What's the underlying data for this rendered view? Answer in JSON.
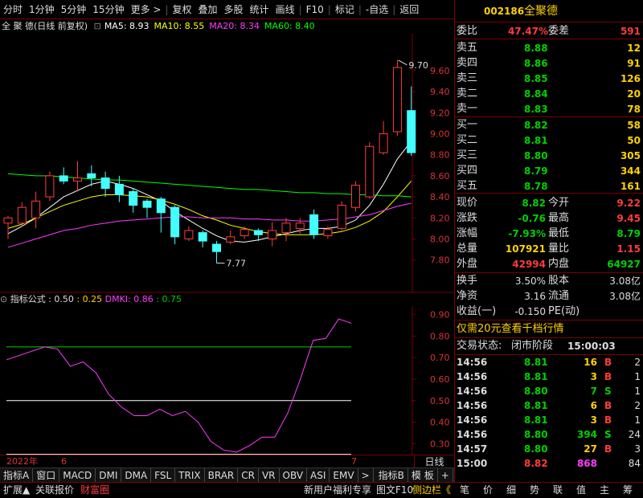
{
  "toolbar": {
    "items": [
      "分时",
      "1分钟",
      "5分钟",
      "15分钟",
      "更多 >",
      "复权",
      "叠加",
      "多股",
      "统计",
      "画线",
      "F10",
      "标记",
      "-自选",
      "返回"
    ]
  },
  "chart_header": {
    "name": "全 聚 德",
    "mode": "(日线 前复权)",
    "ma": [
      {
        "label": "MA5: 8.93",
        "color": "#ffffff"
      },
      {
        "label": "MA10: 8.55",
        "color": "#ffff00"
      },
      {
        "label": "MA20: 8.34",
        "color": "#ff3cff"
      },
      {
        "label": "MA60: 8.40",
        "color": "#00ff00"
      }
    ]
  },
  "chart_data": [
    {
      "type": "candlestick",
      "y_ticks": [
        7.8,
        8.0,
        8.2,
        8.4,
        8.6,
        8.8,
        9.0,
        9.2,
        9.4,
        9.6
      ],
      "ylim": [
        7.66,
        9.92
      ],
      "annotations": [
        {
          "label": "9.70",
          "value": 9.7
        },
        {
          "label": "7.77",
          "value": 7.77
        }
      ],
      "candles": [
        [
          8.15,
          8.2,
          8.22,
          8.0
        ],
        [
          8.15,
          8.3,
          8.35,
          8.12
        ],
        [
          8.2,
          8.36,
          8.45,
          8.1
        ],
        [
          8.4,
          8.6,
          8.64,
          8.36
        ],
        [
          8.6,
          8.55,
          8.68,
          8.52
        ],
        [
          8.55,
          8.58,
          8.74,
          8.45
        ],
        [
          8.62,
          8.58,
          8.7,
          8.5
        ],
        [
          8.58,
          8.48,
          8.64,
          8.4
        ],
        [
          8.52,
          8.42,
          8.6,
          8.35
        ],
        [
          8.45,
          8.32,
          8.48,
          8.25
        ],
        [
          8.36,
          8.3,
          8.38,
          8.2
        ],
        [
          8.38,
          8.25,
          8.4,
          8.06
        ],
        [
          8.3,
          8.02,
          8.32,
          7.95
        ],
        [
          8.0,
          8.08,
          8.12,
          7.98
        ],
        [
          8.06,
          7.98,
          8.08,
          7.92
        ],
        [
          7.95,
          7.88,
          7.98,
          7.77
        ],
        [
          7.97,
          8.02,
          8.08,
          7.95
        ],
        [
          8.03,
          8.09,
          8.12,
          8.0
        ],
        [
          8.08,
          8.04,
          8.1,
          7.98
        ],
        [
          8.0,
          8.08,
          8.16,
          7.93
        ],
        [
          8.06,
          8.15,
          8.2,
          7.98
        ],
        [
          8.1,
          8.15,
          8.2,
          8.05
        ],
        [
          8.23,
          8.04,
          8.28,
          8.0
        ],
        [
          8.03,
          8.09,
          8.12,
          8.0
        ],
        [
          8.1,
          8.32,
          8.36,
          8.08
        ],
        [
          8.3,
          8.51,
          8.55,
          8.26
        ],
        [
          8.4,
          8.88,
          8.92,
          8.38
        ],
        [
          8.82,
          9.0,
          9.12,
          8.8
        ],
        [
          9.02,
          9.63,
          9.7,
          8.98
        ],
        [
          9.22,
          8.82,
          9.45,
          8.79
        ]
      ],
      "ma_series": [
        {
          "name": "MA5",
          "color": "#ffffff",
          "values": [
            8.05,
            8.12,
            8.2,
            8.3,
            8.4,
            8.46,
            8.52,
            8.55,
            8.52,
            8.48,
            8.42,
            8.36,
            8.26,
            8.18,
            8.1,
            8.03,
            7.98,
            7.97,
            7.99,
            8.02,
            8.05,
            8.08,
            8.1,
            8.1,
            8.12,
            8.18,
            8.32,
            8.52,
            8.76,
            8.93
          ]
        },
        {
          "name": "MA10",
          "color": "#ffff00",
          "values": [
            8.1,
            8.14,
            8.2,
            8.26,
            8.32,
            8.36,
            8.4,
            8.42,
            8.42,
            8.41,
            8.4,
            8.37,
            8.33,
            8.28,
            8.22,
            8.18,
            8.13,
            8.1,
            8.07,
            8.05,
            8.04,
            8.04,
            8.04,
            8.05,
            8.07,
            8.11,
            8.17,
            8.26,
            8.4,
            8.55
          ]
        },
        {
          "name": "MA20",
          "color": "#ff3cff",
          "values": [
            7.92,
            7.96,
            8.0,
            8.04,
            8.08,
            8.1,
            8.13,
            8.15,
            8.17,
            8.18,
            8.19,
            8.2,
            8.21,
            8.21,
            8.2,
            8.2,
            8.2,
            8.19,
            8.19,
            8.18,
            8.18,
            8.17,
            8.17,
            8.18,
            8.19,
            8.21,
            8.23,
            8.27,
            8.31,
            8.34
          ]
        },
        {
          "name": "MA60",
          "color": "#00ff00",
          "values": [
            8.62,
            8.61,
            8.6,
            8.6,
            8.59,
            8.58,
            8.57,
            8.56,
            8.56,
            8.55,
            8.54,
            8.53,
            8.52,
            8.51,
            8.5,
            8.49,
            8.48,
            8.47,
            8.47,
            8.46,
            8.45,
            8.44,
            8.44,
            8.43,
            8.43,
            8.42,
            8.42,
            8.41,
            8.41,
            8.4
          ]
        }
      ]
    },
    {
      "type": "line",
      "y_ticks": [
        0.3,
        0.4,
        0.5,
        0.6,
        0.7,
        0.8,
        0.9
      ],
      "ylim": [
        0.26,
        0.94
      ],
      "ref_lines": [
        {
          "value": 0.75,
          "color": "#00d000"
        },
        {
          "value": 0.5,
          "color": "#ffffff"
        },
        {
          "value": 0.25,
          "color": "#ffffff"
        }
      ],
      "series": [
        {
          "name": "DMKI",
          "color": "#ff3cff",
          "values": [
            0.69,
            0.71,
            0.73,
            0.75,
            0.74,
            0.66,
            0.68,
            0.63,
            0.53,
            0.47,
            0.43,
            0.43,
            0.46,
            0.43,
            0.45,
            0.4,
            0.31,
            0.27,
            0.26,
            0.29,
            0.33,
            0.33,
            0.44,
            0.6,
            0.78,
            0.79,
            0.88,
            0.86
          ]
        }
      ]
    }
  ],
  "indicator_header": {
    "name": "指标公式",
    "v1": ": 0.50",
    "v2": ": 0.25",
    "v3_label": "DMKI: 0.86",
    "v4": ": 0.75"
  },
  "dates": {
    "year": "2022年",
    "m6": "6",
    "m7": "7",
    "period": "日线"
  },
  "indicator_tabs": [
    "指标A",
    "窗口",
    "MACD",
    "DMI",
    "DMA",
    "FSL",
    "TRIX",
    "BRAR",
    "CR",
    "VR",
    "OBV",
    "ASI",
    "EMV",
    ">",
    "指标B",
    "模 板",
    "+",
    "-"
  ],
  "bottom_bar": {
    "left": [
      "扩展▲",
      "关联报价",
      "财富圈"
    ],
    "right": [
      "新用户福利专享",
      "图文F10",
      "侧边栏《"
    ],
    "icons": [
      "笔",
      "价",
      "细",
      "势",
      "联",
      "值",
      "主",
      "筹"
    ]
  },
  "quote": {
    "code": "002186",
    "name": "全聚德",
    "weibi_label": "委比",
    "weibi": "47.47%",
    "weicha_label": "委差",
    "weicha": "591",
    "asks": [
      {
        "label": "卖五",
        "price": "8.88",
        "vol": "12"
      },
      {
        "label": "卖四",
        "price": "8.86",
        "vol": "91"
      },
      {
        "label": "卖三",
        "price": "8.85",
        "vol": "126"
      },
      {
        "label": "卖二",
        "price": "8.84",
        "vol": "20"
      },
      {
        "label": "卖一",
        "price": "8.83",
        "vol": "78"
      }
    ],
    "bids": [
      {
        "label": "买一",
        "price": "8.82",
        "vol": "58"
      },
      {
        "label": "买二",
        "price": "8.81",
        "vol": "50"
      },
      {
        "label": "买三",
        "price": "8.80",
        "vol": "305"
      },
      {
        "label": "买四",
        "price": "8.79",
        "vol": "344"
      },
      {
        "label": "买五",
        "price": "8.78",
        "vol": "161"
      }
    ],
    "stats": [
      {
        "l1": "现价",
        "v1": "8.82",
        "c1": "green",
        "l2": "今开",
        "v2": "9.22",
        "c2": "red"
      },
      {
        "l1": "涨跌",
        "v1": "-0.76",
        "c1": "green",
        "l2": "最高",
        "v2": "9.45",
        "c2": "red"
      },
      {
        "l1": "涨幅",
        "v1": "-7.93%",
        "c1": "green",
        "l2": "最低",
        "v2": "8.79",
        "c2": "green"
      },
      {
        "l1": "总量",
        "v1": "107921",
        "c1": "yellow",
        "l2": "量比",
        "v2": "1.15",
        "c2": "red"
      },
      {
        "l1": "外盘",
        "v1": "42994",
        "c1": "red",
        "l2": "内盘",
        "v2": "64927",
        "c2": "green"
      }
    ],
    "stats2": [
      {
        "l1": "换手",
        "v1": "3.50%",
        "l2": "股本",
        "v2": "3.08亿"
      },
      {
        "l1": "净资",
        "v1": "3.16",
        "l2": "流通",
        "v2": "3.08亿"
      },
      {
        "l1": "收益(一)",
        "v1": "-0.150",
        "l2": "PE(动)",
        "v2": ""
      }
    ],
    "promo": "仅需20元查看千档行情",
    "status_label": "交易状态:",
    "status": "闭市阶段",
    "status_time": "15:00:03",
    "ticks": [
      {
        "t": "14:56",
        "p": "8.81",
        "v": "16",
        "d": "B",
        "n": "2"
      },
      {
        "t": "14:56",
        "p": "8.81",
        "v": "3",
        "d": "B",
        "n": "1"
      },
      {
        "t": "14:56",
        "p": "8.80",
        "v": "7",
        "d": "S",
        "n": "1"
      },
      {
        "t": "14:56",
        "p": "8.81",
        "v": "6",
        "d": "B",
        "n": "2"
      },
      {
        "t": "14:56",
        "p": "8.81",
        "v": "3",
        "d": "B",
        "n": "1"
      },
      {
        "t": "14:56",
        "p": "8.80",
        "v": "394",
        "d": "S",
        "n": "24"
      },
      {
        "t": "14:57",
        "p": "8.80",
        "v": "27",
        "d": "B",
        "n": "3"
      },
      {
        "t": "15:00",
        "p": "8.82",
        "v": "868",
        "d": "",
        "n": "84"
      }
    ]
  }
}
